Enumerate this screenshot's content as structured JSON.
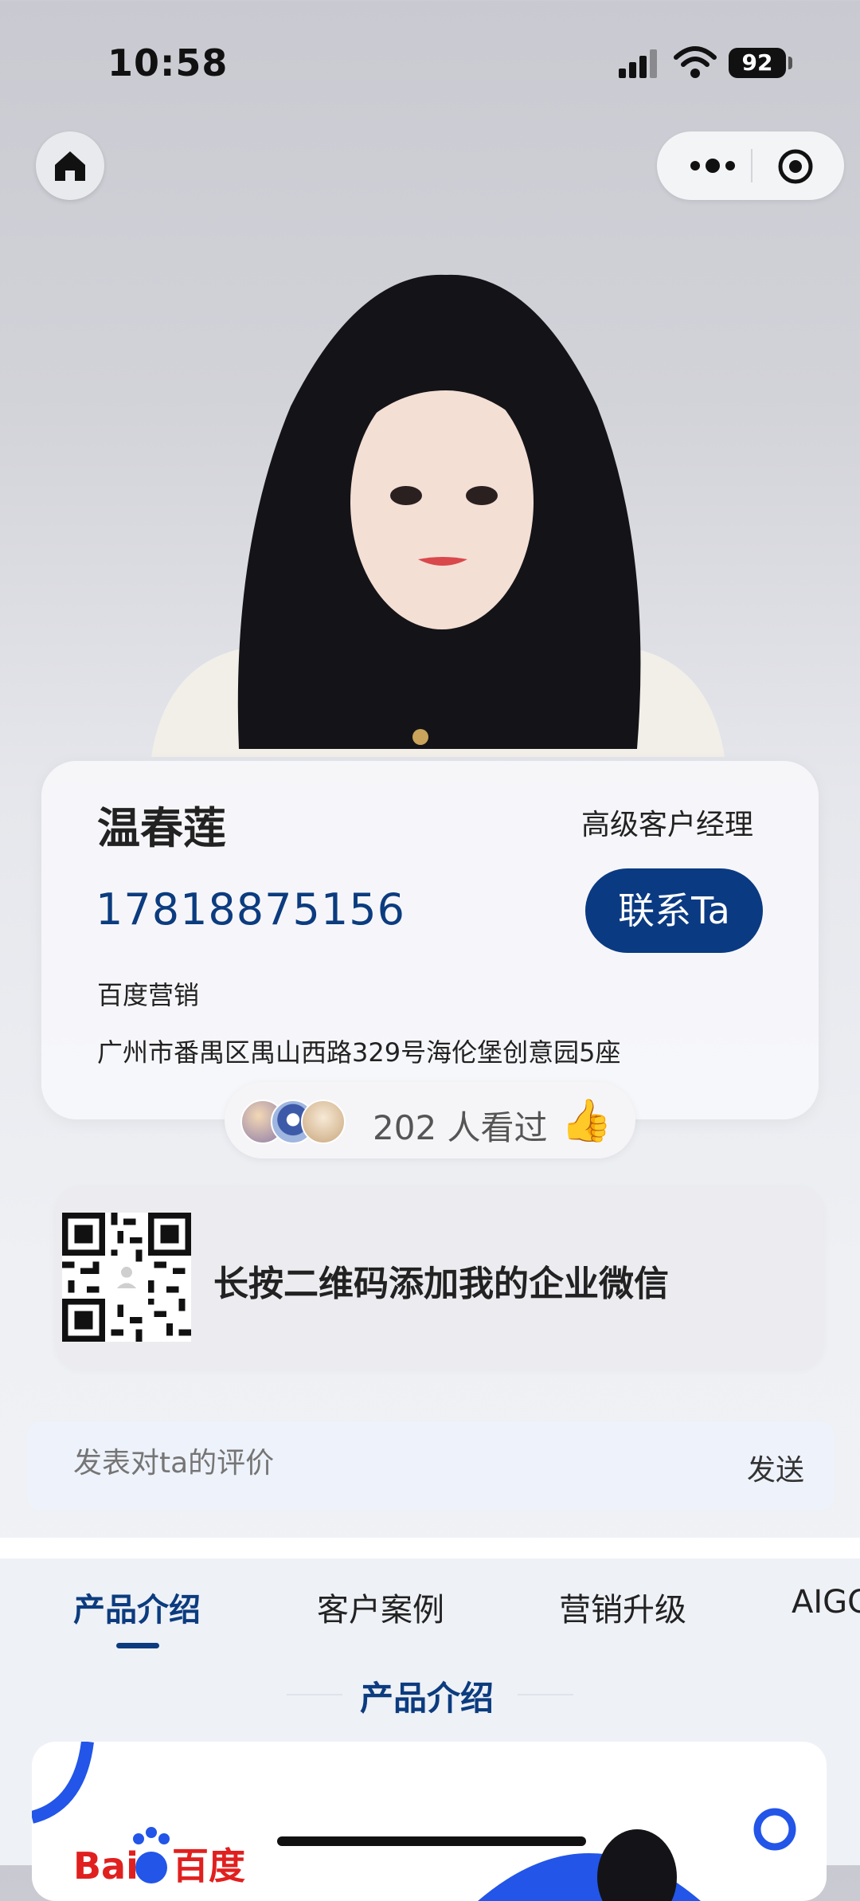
{
  "status_bar": {
    "time": "10:58",
    "battery": "92"
  },
  "nav": {
    "home_icon": "home-icon",
    "more_icon": "more-dots-icon",
    "close_icon": "target-close-icon"
  },
  "profile": {
    "name": "温春莲",
    "role": "高级客户经理",
    "phone": "17818875156",
    "contact_label": "联系Ta",
    "company": "百度营销",
    "address": "广州市番禺区禺山西路329号海伦堡创意园5座"
  },
  "viewers": {
    "count_text": "202 人看过",
    "emoji": "👍"
  },
  "qr": {
    "text": "长按二维码添加我的企业微信"
  },
  "comment": {
    "placeholder": "发表对ta的评价",
    "send_label": "发送"
  },
  "tabs": [
    {
      "label": "产品介绍",
      "active": true
    },
    {
      "label": "客户案例",
      "active": false
    },
    {
      "label": "营销升级",
      "active": false
    },
    {
      "label": "AIGC",
      "active": false
    }
  ],
  "section": {
    "title": "产品介绍"
  },
  "product_card": {
    "brand": "百度"
  },
  "colors": {
    "brand_navy": "#0a3a82",
    "accent_blue": "#2255e8"
  }
}
